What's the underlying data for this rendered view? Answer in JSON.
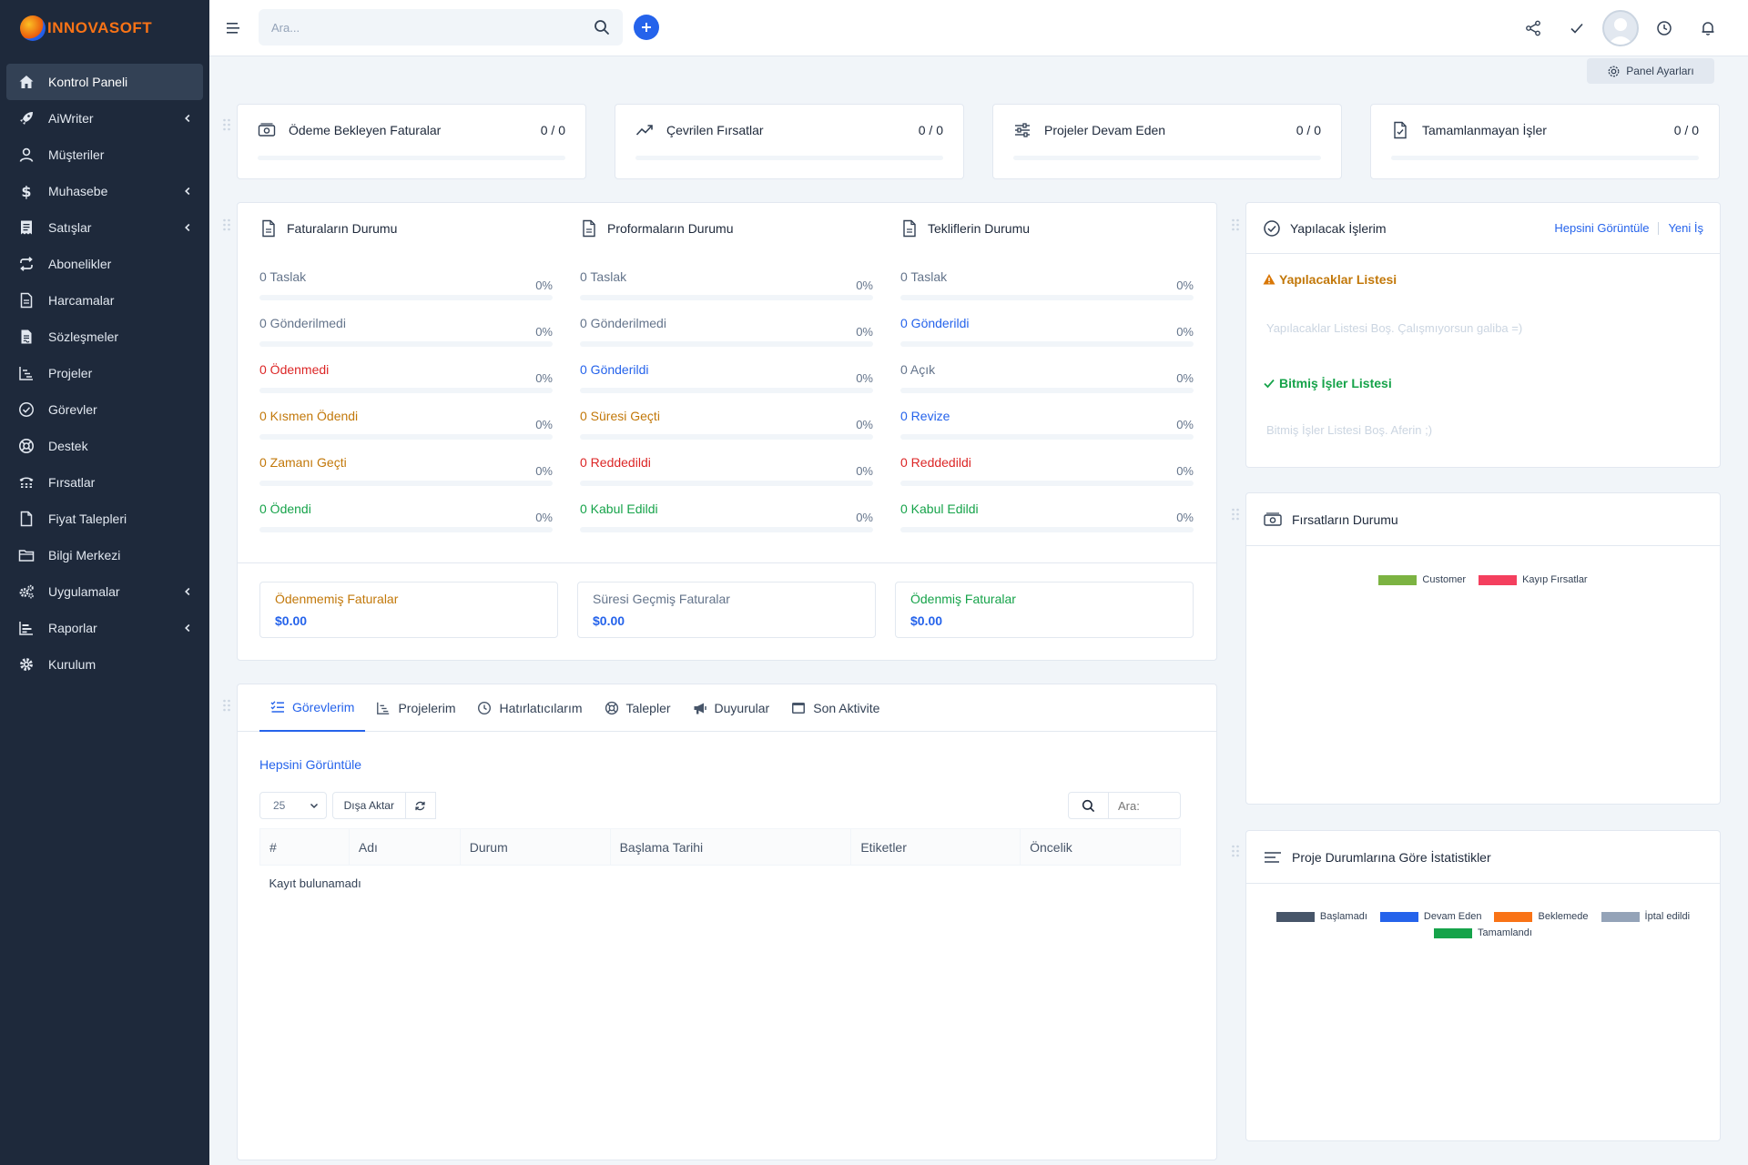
{
  "brand": {
    "name": "INNOVASOFT"
  },
  "sidebar": {
    "items": [
      {
        "label": "Kontrol Paneli",
        "icon": "home-icon",
        "active": true,
        "chevron": false
      },
      {
        "label": "AiWriter",
        "icon": "rocket-icon",
        "chevron": true
      },
      {
        "label": "Müşteriler",
        "icon": "user-icon",
        "chevron": false
      },
      {
        "label": "Muhasebe",
        "icon": "dollar-icon",
        "chevron": true
      },
      {
        "label": "Satışlar",
        "icon": "receipt-icon",
        "chevron": true
      },
      {
        "label": "Abonelikler",
        "icon": "repeat-icon",
        "chevron": false
      },
      {
        "label": "Harcamalar",
        "icon": "document-icon",
        "chevron": false
      },
      {
        "label": "Sözleşmeler",
        "icon": "contract-icon",
        "chevron": false
      },
      {
        "label": "Projeler",
        "icon": "chart-icon",
        "chevron": false
      },
      {
        "label": "Görevler",
        "icon": "check-circle-icon",
        "chevron": false
      },
      {
        "label": "Destek",
        "icon": "lifebuoy-icon",
        "chevron": false
      },
      {
        "label": "Fırsatlar",
        "icon": "tty-icon",
        "chevron": false
      },
      {
        "label": "Fiyat Talepleri",
        "icon": "file-icon",
        "chevron": false
      },
      {
        "label": "Bilgi Merkezi",
        "icon": "folder-icon",
        "chevron": false
      },
      {
        "label": "Uygulamalar",
        "icon": "cogs-icon",
        "chevron": true
      },
      {
        "label": "Raporlar",
        "icon": "bar-chart-icon",
        "chevron": true
      },
      {
        "label": "Kurulum",
        "icon": "gear-icon",
        "chevron": false
      }
    ]
  },
  "topbar": {
    "search_placeholder": "Ara..."
  },
  "panel_settings_label": "Panel Ayarları",
  "stats": [
    {
      "title": "Ödeme Bekleyen Faturalar",
      "value": "0 / 0",
      "icon": "money-icon",
      "progress": 0
    },
    {
      "title": "Çevrilen Fırsatlar",
      "value": "0 / 0",
      "icon": "trend-up-icon",
      "progress": 0
    },
    {
      "title": "Projeler Devam Eden",
      "value": "0 / 0",
      "icon": "sliders-icon",
      "progress": 0
    },
    {
      "title": "Tamamlanmayan İşler",
      "value": "0 / 0",
      "icon": "file-check-icon",
      "progress": 0
    }
  ],
  "status_columns": [
    {
      "title": "Faturaların Durumu",
      "rows": [
        {
          "label": "0 Taslak",
          "pct": "0%",
          "tone": "default"
        },
        {
          "label": "0 Gönderilmedi",
          "pct": "0%",
          "tone": "default"
        },
        {
          "label": "0 Ödenmedi",
          "pct": "0%",
          "tone": "red"
        },
        {
          "label": "0 Kısmen Ödendi",
          "pct": "0%",
          "tone": "orange"
        },
        {
          "label": "0 Zamanı Geçti",
          "pct": "0%",
          "tone": "orange"
        },
        {
          "label": "0 Ödendi",
          "pct": "0%",
          "tone": "green"
        }
      ]
    },
    {
      "title": "Proformaların Durumu",
      "rows": [
        {
          "label": "0 Taslak",
          "pct": "0%",
          "tone": "default"
        },
        {
          "label": "0 Gönderilmedi",
          "pct": "0%",
          "tone": "default"
        },
        {
          "label": "0 Gönderildi",
          "pct": "0%",
          "tone": "blue"
        },
        {
          "label": "0 Süresi Geçti",
          "pct": "0%",
          "tone": "orange"
        },
        {
          "label": "0 Reddedildi",
          "pct": "0%",
          "tone": "red"
        },
        {
          "label": "0 Kabul Edildi",
          "pct": "0%",
          "tone": "green"
        }
      ]
    },
    {
      "title": "Tekliflerin Durumu",
      "rows": [
        {
          "label": "0 Taslak",
          "pct": "0%",
          "tone": "default"
        },
        {
          "label": "0 Gönderildi",
          "pct": "0%",
          "tone": "blue"
        },
        {
          "label": "0 Açık",
          "pct": "0%",
          "tone": "default"
        },
        {
          "label": "0 Revize",
          "pct": "0%",
          "tone": "blue"
        },
        {
          "label": "0 Reddedildi",
          "pct": "0%",
          "tone": "red"
        },
        {
          "label": "0 Kabul Edildi",
          "pct": "0%",
          "tone": "green"
        }
      ]
    }
  ],
  "summary": [
    {
      "title": "Ödenmemiş Faturalar",
      "value": "$0.00",
      "tone": "orange"
    },
    {
      "title": "Süresi Geçmiş Faturalar",
      "value": "$0.00",
      "tone": "default"
    },
    {
      "title": "Ödenmiş Faturalar",
      "value": "$0.00",
      "tone": "green"
    }
  ],
  "todo": {
    "title": "Yapılacak İşlerim",
    "view_all": "Hepsini Görüntüle",
    "new": "Yeni İş",
    "list_title": "Yapılacaklar Listesi",
    "list_empty": "Yapılacaklar Listesi Boş. Çalışmıyorsun galiba =)",
    "done_title": "Bitmiş İşler Listesi",
    "done_empty": "Bitmiş İşler Listesi Boş. Aferin ;)"
  },
  "opportunities": {
    "title": "Fırsatların Durumu",
    "legend": [
      {
        "name": "Customer",
        "color": "#7cb342"
      },
      {
        "name": "Kayıp Fırsatlar",
        "color": "#f43f5e"
      }
    ]
  },
  "project_stats": {
    "title": "Proje Durumlarına Göre İstatistikler",
    "legend": [
      {
        "name": "Başlamadı",
        "color": "#475569"
      },
      {
        "name": "Devam Eden",
        "color": "#2563eb"
      },
      {
        "name": "Beklemede",
        "color": "#f97316"
      },
      {
        "name": "İptal edildi",
        "color": "#94a3b8"
      },
      {
        "name": "Tamamlandı",
        "color": "#16a34a"
      }
    ]
  },
  "tabs": {
    "items": [
      {
        "label": "Görevlerim",
        "icon": "task-list-icon",
        "active": true
      },
      {
        "label": "Projelerim",
        "icon": "chart-icon"
      },
      {
        "label": "Hatırlatıcılarım",
        "icon": "clock-icon"
      },
      {
        "label": "Talepler",
        "icon": "lifebuoy-icon"
      },
      {
        "label": "Duyurular",
        "icon": "megaphone-icon"
      },
      {
        "label": "Son Aktivite",
        "icon": "window-icon"
      }
    ],
    "view_all": "Hepsini Görüntüle",
    "page_size": "25",
    "export_label": "Dışa Aktar",
    "table_search_placeholder": "Ara:",
    "columns": [
      "#",
      "Adı",
      "Durum",
      "Başlama Tarihi",
      "Etiketler",
      "Öncelik"
    ],
    "empty": "Kayıt bulunamadı"
  }
}
